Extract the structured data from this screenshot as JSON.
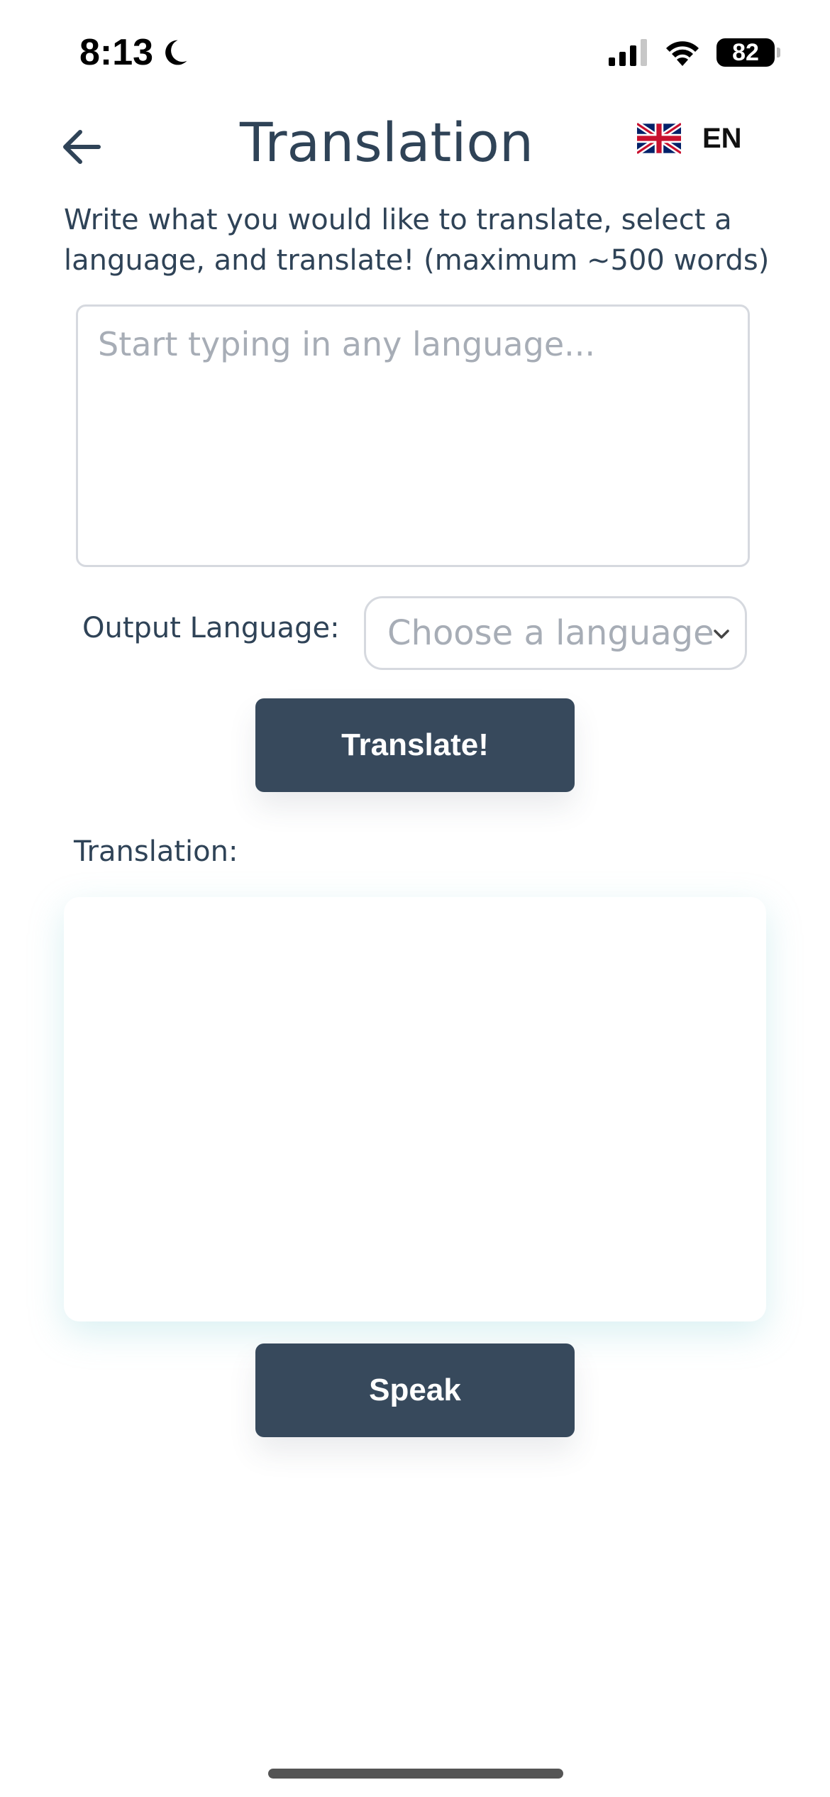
{
  "status_bar": {
    "time": "8:13",
    "battery": "82",
    "icons": [
      "moon-icon",
      "signal-icon",
      "wifi-icon",
      "battery-icon"
    ]
  },
  "header": {
    "title": "Translation",
    "language_code": "EN",
    "icons": [
      "back-arrow-icon",
      "uk-flag-icon"
    ]
  },
  "instructions": "Write what you would like to translate, select a language, and translate! (maximum ~500 words)",
  "source_input": {
    "value": "",
    "placeholder": "Start typing in any language..."
  },
  "output_language": {
    "label": "Output Language:",
    "selected": "Choose a language"
  },
  "translate_button": "Translate!",
  "translation": {
    "label": "Translation:",
    "text": ""
  },
  "speak_button": "Speak",
  "colors": {
    "primary": "#37495c",
    "text": "#2f4357",
    "placeholder": "#a7adb6",
    "border": "#d6d9df"
  }
}
